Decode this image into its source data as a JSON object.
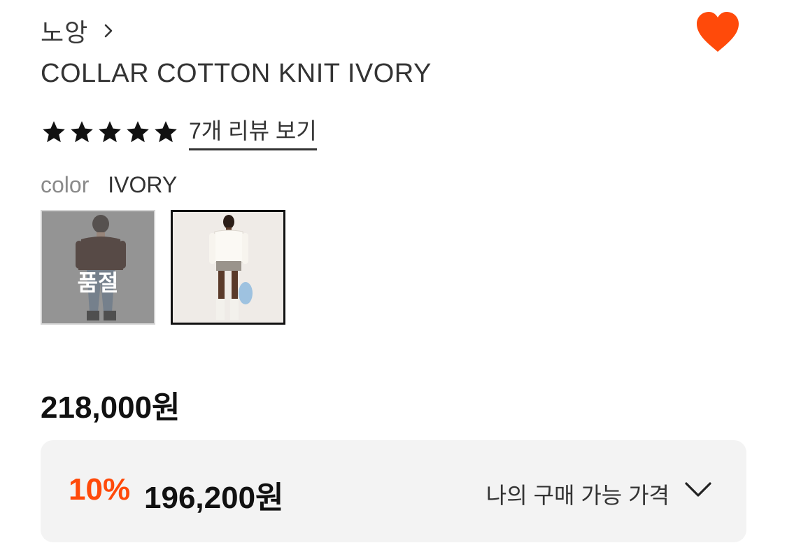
{
  "brand": {
    "name": "노앙"
  },
  "product": {
    "title": "COLLAR COTTON KNIT IVORY"
  },
  "rating": {
    "stars": 5,
    "review_link": "7개 리뷰 보기"
  },
  "color": {
    "label": "color",
    "value": "IVORY"
  },
  "swatches": [
    {
      "state": "sold-out",
      "overlay_text": "품절"
    },
    {
      "state": "selected"
    }
  ],
  "price": {
    "original": "218,000원"
  },
  "discount": {
    "rate": "10%",
    "price": "196,200원",
    "label": "나의 구매 가능 가격"
  },
  "colors": {
    "accent": "#ff4a0a",
    "heart": "#ff4a0a",
    "panel": "#f3f3f3"
  },
  "icons": {
    "brand_arrow": "chevron-right-icon",
    "wishlist": "heart-icon",
    "expand": "chevron-down-icon"
  }
}
